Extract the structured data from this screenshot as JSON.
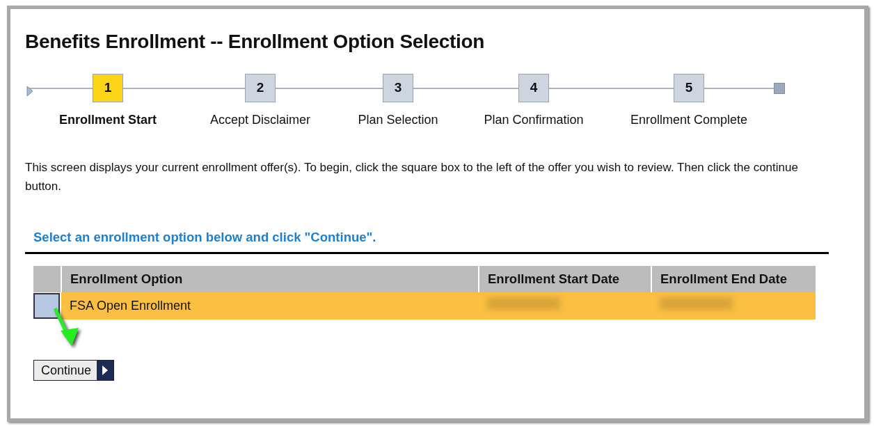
{
  "title": "Benefits Enrollment -- Enrollment Option Selection",
  "steps": [
    {
      "number": "1",
      "label": "Enrollment Start",
      "selected": true
    },
    {
      "number": "2",
      "label": "Accept Disclaimer",
      "selected": false
    },
    {
      "number": "3",
      "label": "Plan Selection",
      "selected": false
    },
    {
      "number": "4",
      "label": "Plan Confirmation",
      "selected": false
    },
    {
      "number": "5",
      "label": "Enrollment Complete",
      "selected": false
    }
  ],
  "instructions": "This screen displays your current enrollment offer(s).  To begin, click the square box to the left of the offer you wish to review.  Then click the continue button.",
  "section_heading": "Select an enrollment option below and click \"Continue\".",
  "table": {
    "columns": [
      "Enrollment Option",
      "Enrollment Start Date",
      "Enrollment End Date"
    ],
    "rows": [
      {
        "option": "FSA Open Enrollment",
        "checked": false,
        "highlighted": true,
        "start_date_redacted": true,
        "end_date_redacted": true
      }
    ]
  },
  "annotation_arrow": true,
  "continue_button": "Continue"
}
